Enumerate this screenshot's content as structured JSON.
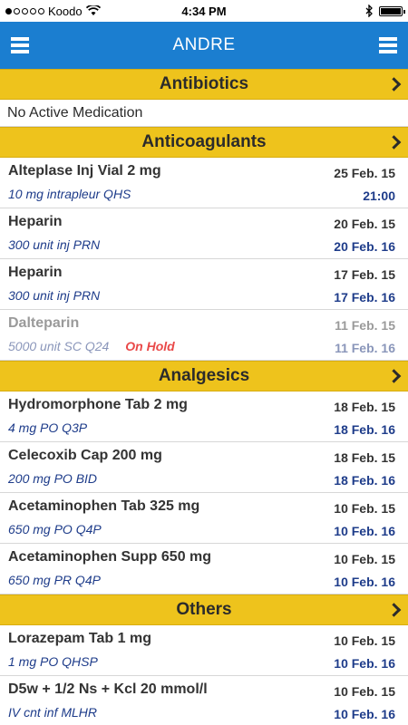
{
  "status_bar": {
    "carrier": "Koodo",
    "time": "4:34 PM",
    "signal_bars_filled": 1,
    "signal_bars_total": 5,
    "battery_level": 1.0
  },
  "nav": {
    "title": "ANDRE",
    "color": "#1b7ed0"
  },
  "theme": {
    "section_color": "#eec31c",
    "dose_color": "#1e3c8a",
    "hold_color": "#e94848"
  },
  "sections": {
    "antibiotics": {
      "title": "Antibiotics",
      "empty_text": "No Active Medication"
    },
    "anticoagulants": {
      "title": "Anticoagulants",
      "items": [
        {
          "name": "Alteplase Inj Vial 2 mg",
          "dose": "10 mg intrapleur QHS",
          "start": "25 Feb. 15",
          "end": "21:00"
        },
        {
          "name": "Heparin",
          "dose": "300 unit inj PRN",
          "start": "20 Feb. 15",
          "end": "20 Feb. 16"
        },
        {
          "name": "Heparin",
          "dose": "300 unit inj PRN",
          "start": "17 Feb. 15",
          "end": "17 Feb. 16"
        },
        {
          "name": "Dalteparin",
          "dose": "5000 unit SC Q24",
          "status": "On Hold",
          "start": "11 Feb. 15",
          "end": "11 Feb. 16"
        }
      ]
    },
    "analgesics": {
      "title": "Analgesics",
      "items": [
        {
          "name": "Hydromorphone Tab 2 mg",
          "dose": "4 mg PO Q3P",
          "start": "18 Feb. 15",
          "end": "18 Feb. 16"
        },
        {
          "name": "Celecoxib Cap 200 mg",
          "dose": "200 mg PO BID",
          "start": "18 Feb. 15",
          "end": "18 Feb. 16"
        },
        {
          "name": "Acetaminophen Tab 325 mg",
          "dose": "650 mg PO Q4P",
          "start": "10 Feb. 15",
          "end": "10 Feb. 16"
        },
        {
          "name": "Acetaminophen Supp 650 mg",
          "dose": "650 mg PR Q4P",
          "start": "10 Feb. 15",
          "end": "10 Feb. 16"
        }
      ]
    },
    "others": {
      "title": "Others",
      "items": [
        {
          "name": "Lorazepam Tab 1 mg",
          "dose": "1 mg PO QHSP",
          "start": "10 Feb. 15",
          "end": "10 Feb. 16"
        },
        {
          "name": "D5w + 1/2 Ns + Kcl 20 mmol/l",
          "dose": "IV cnt inf MLHR",
          "start": "10 Feb. 15",
          "end": "10 Feb. 16"
        }
      ]
    }
  },
  "icons": {
    "menu_left": "hamburger-menu-icon",
    "menu_right": "hamburger-menu-icon",
    "section_chevron": "chevron-right-icon",
    "wifi": "wifi-icon",
    "bluetooth": "bluetooth-icon",
    "battery": "battery-icon"
  }
}
